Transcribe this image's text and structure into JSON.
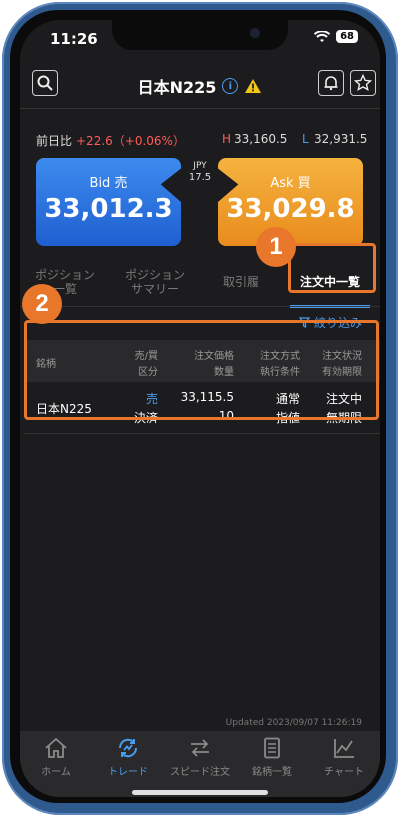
{
  "status_bar": {
    "time": "11:26",
    "battery": "68"
  },
  "header": {
    "title": "日本N225"
  },
  "price_row": {
    "prev_label": "前日比",
    "change": "+22.6（+0.06%）",
    "high_label": "H",
    "high": "33,160.5",
    "low_label": "L",
    "low": "32,931.5"
  },
  "quote": {
    "bid_label": "Bid 売",
    "bid": "33,012.3",
    "ask_label": "Ask 買",
    "ask": "33,029.8",
    "currency": "JPY",
    "spread": "17.5"
  },
  "tabs": [
    {
      "label": "ポジション\n一覧"
    },
    {
      "label": "ポジション\nサマリー"
    },
    {
      "label": "取引履"
    },
    {
      "label": "注文中一覧"
    }
  ],
  "filter_label": "絞り込み",
  "table": {
    "headers": {
      "symbol": "銘柄",
      "side_top": "売/買",
      "side_bottom": "区分",
      "price_top": "注文価格",
      "price_bottom": "数量",
      "method_top": "注文方式",
      "method_bottom": "執行条件",
      "status_top": "注文状況",
      "status_bottom": "有効期限"
    },
    "rows": [
      {
        "symbol": "日本N225",
        "side": "売",
        "category": "決済",
        "price": "33,115.5",
        "qty": "10",
        "method": "通常",
        "condition": "指値",
        "status": "注文中",
        "expiry": "無期限"
      }
    ]
  },
  "callouts": [
    "1",
    "2"
  ],
  "updated": "Updated 2023/09/07 11:26:19",
  "tabbar": [
    {
      "label": "ホーム",
      "icon": "home-icon"
    },
    {
      "label": "トレード",
      "icon": "trade-icon"
    },
    {
      "label": "スピード注文",
      "icon": "speed-order-icon"
    },
    {
      "label": "銘柄一覧",
      "icon": "list-icon"
    },
    {
      "label": "チャート",
      "icon": "chart-icon"
    }
  ],
  "colors": {
    "accent": "#4a9cf0",
    "bid": "#2a6fe0",
    "ask": "#f0a030",
    "highlight": "#e8762b",
    "up": "#ff5a5a"
  }
}
